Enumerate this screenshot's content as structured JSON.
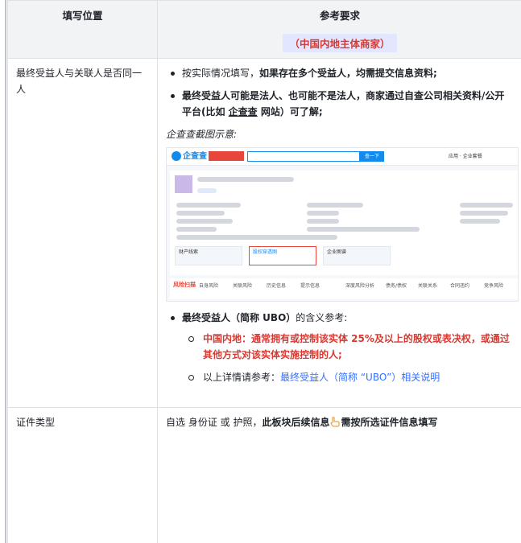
{
  "header": {
    "col1": "填写位置",
    "col2": "参考要求",
    "col2_sub": "（中国内地主体商家）"
  },
  "row1": {
    "label": "最终受益人与关联人是否同一人",
    "bullet1_a": "按实际情况填写，",
    "bullet1_b": "如果存在多个受益人，均需提交信息资料;",
    "bullet2_a": "最终受益人可能是法人、也可能不是法人，商家通过自查公司相关资料/公开平台(比如 ",
    "bullet2_link": "企查查",
    "bullet2_b": " 网站）可了解;",
    "caption": "企查查截图示意:",
    "screenshot": {
      "logo": "企查查",
      "search_btn": "查一下",
      "top_right": "应用 · 企业套餐",
      "box1": "财产线索",
      "box2": "股权穿透图",
      "box3": "企业图谱",
      "tab_risk": "风险扫描",
      "tabs": [
        "自身风险",
        "关联风险",
        "历史信息",
        "提示信息",
        "深度风险分析",
        "债务/债权",
        "关联关系",
        "合同违约",
        "竞争风险"
      ]
    },
    "bullet3_a": "最终受益人（简称 UBO）",
    "bullet3_b": "的含义参考:",
    "sub1": "中国内地：通常拥有或控制该实体 25%及以上的股权或表决权，或通过其他方式对该实体实施控制的人;",
    "sub2_a": "以上详情请参考：",
    "sub2_link": "最终受益人（简称 “UBO”）相关说明"
  },
  "row2": {
    "label": "证件类型",
    "text_a": "自选 身份证 或 护照，",
    "text_b": "此板块后续信息",
    "text_c": "需按所选证件信息填写"
  }
}
